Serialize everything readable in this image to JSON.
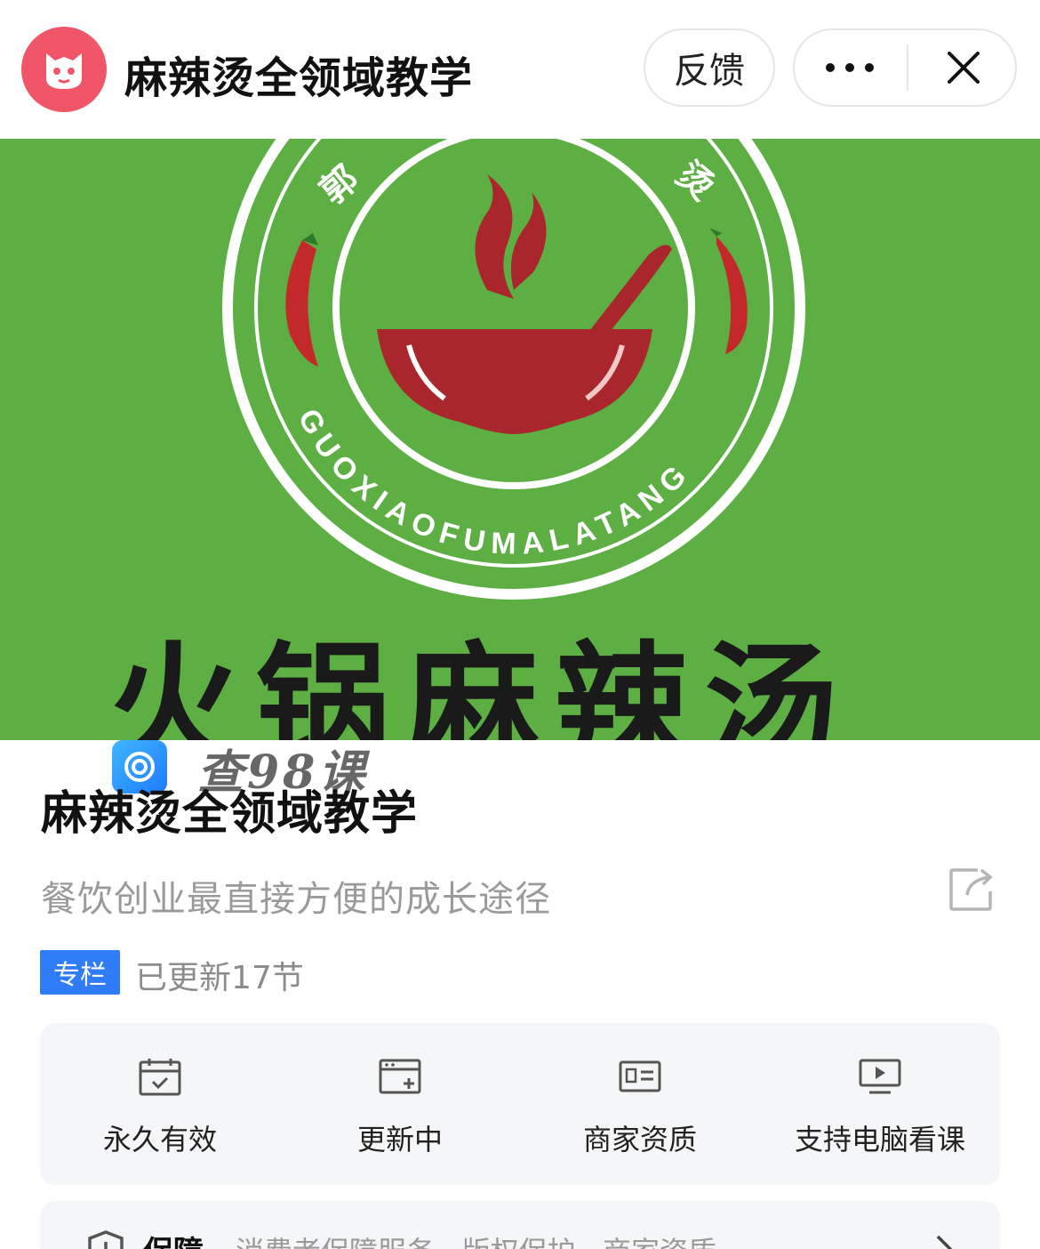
{
  "header": {
    "title": "麻辣烫全领域教学",
    "feedback_label": "反馈",
    "more_icon": "more-dots-icon",
    "close_icon": "close-icon"
  },
  "banner": {
    "logo_ring_text": "GUOXIAOFUMALATANG",
    "bottom_text": "火锅麻辣汤",
    "colors": {
      "background": "#5daf43",
      "bowl": "#a8262c",
      "ring": "#ffffff"
    }
  },
  "watermark": {
    "text": "查98课"
  },
  "course": {
    "title": "麻辣烫全领域教学",
    "subtitle": "餐饮创业最直接方便的成长途径",
    "tag": "专栏",
    "update_text": "已更新17节"
  },
  "features": [
    {
      "icon": "calendar-check-icon",
      "label": "永久有效"
    },
    {
      "icon": "update-card-icon",
      "label": "更新中"
    },
    {
      "icon": "id-card-icon",
      "label": "商家资质"
    },
    {
      "icon": "monitor-play-icon",
      "label": "支持电脑看课"
    }
  ],
  "guarantee": {
    "title": "保障",
    "description": "消费者保障服务 · 版权保护 · 商家资质"
  },
  "colors": {
    "accent": "#2f7cf6",
    "app_logo": "#f05667"
  }
}
